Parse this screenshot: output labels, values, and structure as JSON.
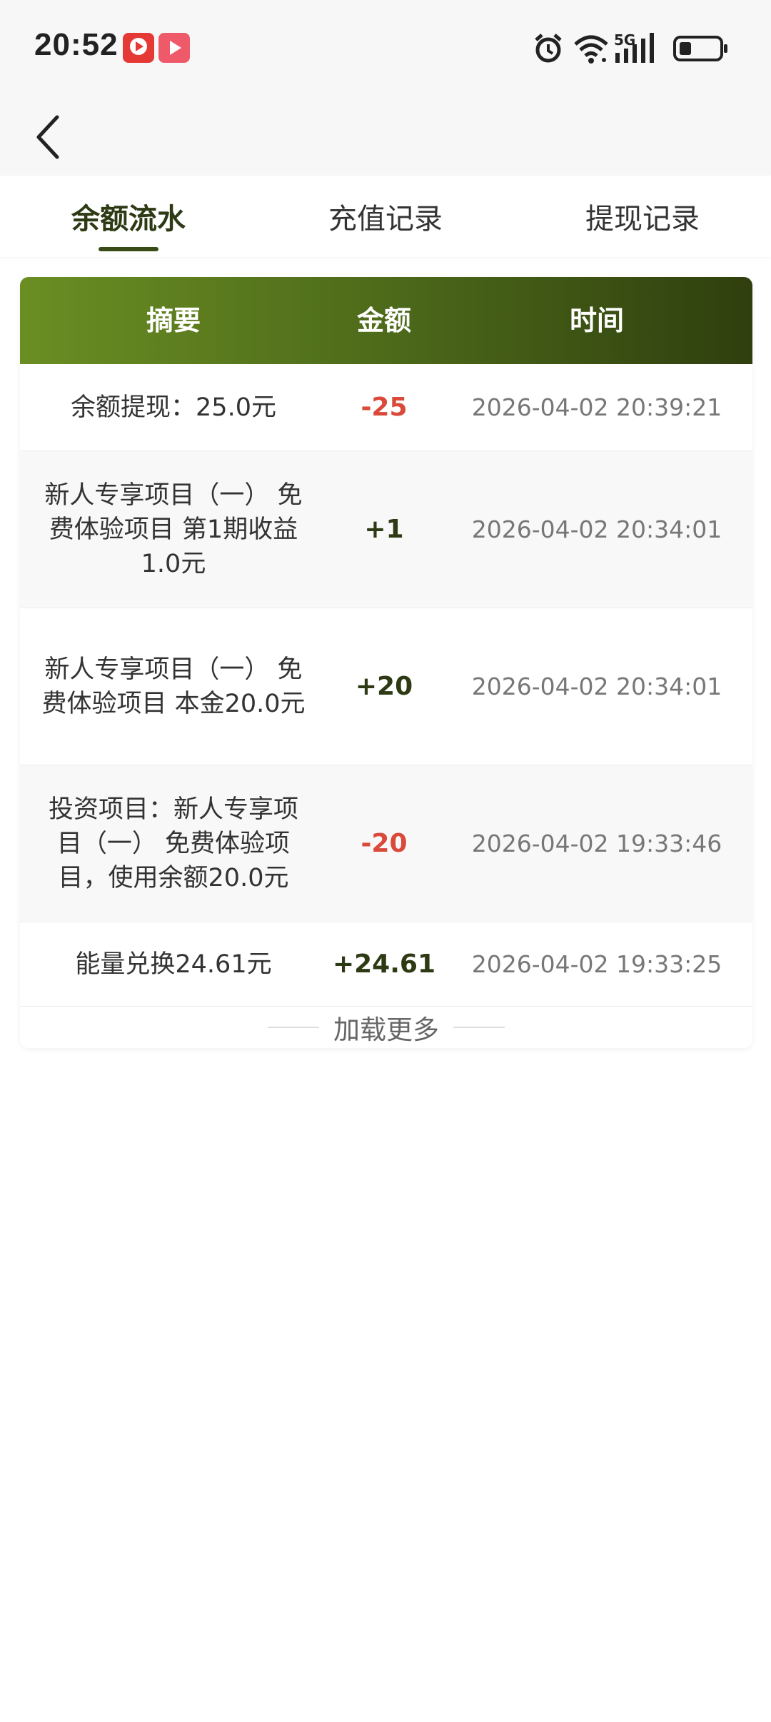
{
  "status_bar": {
    "time": "20:52",
    "network": "5G"
  },
  "tabs": [
    {
      "label": "余额流水",
      "active": true
    },
    {
      "label": "充值记录",
      "active": false
    },
    {
      "label": "提现记录",
      "active": false
    }
  ],
  "table": {
    "headers": {
      "summary": "摘要",
      "amount": "金额",
      "time": "时间"
    },
    "rows": [
      {
        "summary": "余额提现：25.0元",
        "amount": "-25",
        "time": "2026-04-02 20:39:21"
      },
      {
        "summary": "新人专享项目（一） 免费体验项目 第1期收益1.0元",
        "amount": "+1",
        "time": "2026-04-02 20:34:01"
      },
      {
        "summary": "新人专享项目（一） 免费体验项目 本金20.0元",
        "amount": "+20",
        "time": "2026-04-02 20:34:01"
      },
      {
        "summary": "投资项目：新人专享项目（一） 免费体验项目，使用余额20.0元",
        "amount": "-20",
        "time": "2026-04-02 19:33:46"
      },
      {
        "summary": "能量兑换24.61元",
        "amount": "+24.61",
        "time": "2026-04-02 19:33:25"
      }
    ]
  },
  "load_more": "加载更多",
  "colors": {
    "accent": "#3a4c16",
    "header_gradient_start": "#6b8e23",
    "header_gradient_end": "#2f3f0e",
    "negative": "#d94a3a",
    "positive": "#2d3a14"
  },
  "icons": [
    "back-arrow-icon",
    "alarm-icon",
    "wifi-icon",
    "signal-icon",
    "battery-icon"
  ]
}
